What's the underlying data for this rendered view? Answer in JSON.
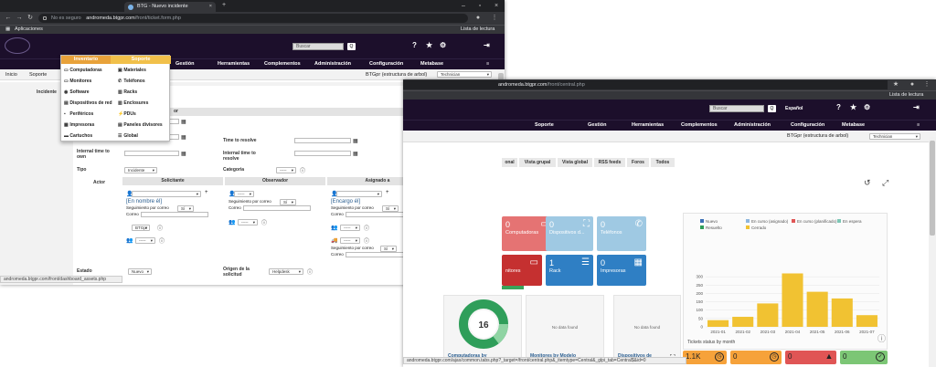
{
  "win1": {
    "tab_title": "BTG - Nuevo incidente",
    "address_insecure": "No es seguro",
    "url_host": "andromeda.btgpr.com",
    "url_path": "/front/ticket.form.php",
    "bookmarks_label": "Aplicaciones",
    "reading_list": "Lista de lectura",
    "search_placeholder": "Buscar",
    "search_btn": "Q",
    "menu": [
      "Inventario",
      "Soporte",
      "Gestión",
      "Herramientas",
      "Complementos",
      "Administración",
      "Configuración",
      "Metabase"
    ],
    "breadcrumb": {
      "home": "Inicio",
      "section": "Soporte"
    },
    "entity": "BTGpr (estructura de arbol)",
    "profile": "Technician",
    "side_label": "Incidente",
    "dropdown": {
      "inventory": [
        "Computadoras",
        "Monitores",
        "Software",
        "Dispositivos de red",
        "Periféricos",
        "Impresoras",
        "Cartuchos"
      ],
      "support": [
        "Materiales",
        "Teléfonos",
        "Racks",
        "Enclosures",
        "PDUs",
        "Paneles divisores",
        "Global"
      ]
    },
    "form": {
      "header_partial": "or",
      "left_labels": [
        "Internal time to own",
        "Tipo"
      ],
      "right_labels": [
        "Time to resolve",
        "Internal time to resolve",
        "Categoria"
      ],
      "tipo_value": "Incidente",
      "categoria_value": "-----",
      "actor": "Actor",
      "solicitante": "Solicitante",
      "observador": "Observador",
      "asignado": "Asignado a",
      "mi_nombre": "[En nombre él]",
      "encargo": "[Encargo él]",
      "seguimiento": "Seguimiento por correo",
      "si": "Sí",
      "correo": "Correo",
      "btgpr": "BTGpr",
      "dash": "-----",
      "estado": "Estado",
      "estado_value": "Nuevo",
      "origen": "Origen de la solicitud",
      "origen_value": "Helpdesk"
    },
    "status_url": "andromeda.btgpr.com/front/dashboard_assets.php"
  },
  "win2": {
    "url_host": "andromeda.btgpr.com",
    "url_path": "/front/central.php",
    "reading_list": "Lista de lectura",
    "search_placeholder": "Buscar",
    "search_btn": "Q",
    "lang": "Español",
    "menu": [
      "Soporte",
      "Gestión",
      "Herramientas",
      "Complementos",
      "Administración",
      "Configuración",
      "Metabase"
    ],
    "entity": "BTGpr (estructura de arbol)",
    "profile": "Technician",
    "view_tabs": [
      "onal",
      "Vista grupal",
      "Vista global",
      "RSS feeds",
      "Foros",
      "Todos"
    ],
    "tiles": [
      {
        "num": "0",
        "label": "Computadoras",
        "color": "#e57373",
        "icon": "desktop-icon"
      },
      {
        "num": "0",
        "label": "Dispositivos d...",
        "color": "#9fc9e3",
        "icon": "network-icon"
      },
      {
        "num": "0",
        "label": "Teléfonos",
        "color": "#9fc9e3",
        "icon": "phone-icon"
      },
      {
        "num": "",
        "label": "nitores",
        "color": "#c53030",
        "icon": "monitor-icon"
      },
      {
        "num": "1",
        "label": "Rack",
        "color": "#2f7fc4",
        "icon": "rack-icon"
      },
      {
        "num": "0",
        "label": "Impresoras",
        "color": "#2f7fc4",
        "icon": "printer-icon"
      }
    ],
    "donut_value": "16",
    "cards": [
      {
        "nodata": "",
        "title": "Computadoras by"
      },
      {
        "nodata": "No data found",
        "title": "Monitores by Modelo"
      },
      {
        "nodata": "No data found",
        "title": "Dispositivos de"
      }
    ],
    "chart_title": "Tickets status by month",
    "status_url": "andromeda.btgpr.com/ajax/common.tabs.php?_target=/front/central.php&_itemtype=Central&_glpi_tab=Central$&id=0",
    "mini_tiles": [
      {
        "num": "1.1K",
        "color": "#f6a23a",
        "icon": "clock-icon"
      },
      {
        "num": "0",
        "color": "#f6a23a",
        "icon": "clock-icon"
      },
      {
        "num": "0",
        "color": "#e05555",
        "icon": "alert-icon"
      },
      {
        "num": "0",
        "color": "#7cc675",
        "icon": "check-icon"
      }
    ]
  },
  "chart_data": {
    "type": "bar",
    "title": "Tickets status by month",
    "categories": [
      "2021-01",
      "2021-02",
      "2021-03",
      "2021-04",
      "2021-05",
      "2021-06",
      "2021-07"
    ],
    "series": [
      {
        "name": "Cerrado",
        "values": [
          40,
          60,
          140,
          320,
          210,
          170,
          70
        ]
      }
    ],
    "legend": [
      "Nuevo",
      "En curso (asignado)",
      "En curso (planificado)",
      "En espera",
      "Resuelto",
      "Cerrado"
    ],
    "legend_colors": [
      "#3b6fb6",
      "#8fb7de",
      "#e05555",
      "#7cc6b5",
      "#2f9e5a",
      "#f1c232"
    ],
    "ylim": [
      0,
      350
    ],
    "yticks": [
      0,
      50,
      100,
      150,
      200,
      250,
      300
    ],
    "bar_color": "#f1c232",
    "legend_position": "top"
  }
}
